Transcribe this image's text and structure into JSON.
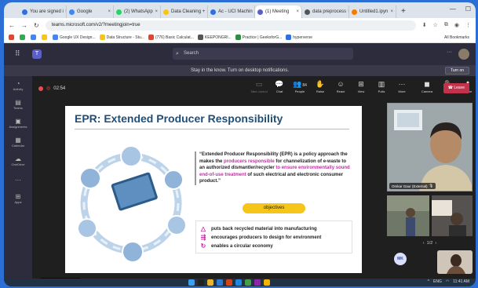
{
  "browser": {
    "tabs": [
      {
        "label": "You are signed i",
        "color": "#2f6fe0",
        "active": false
      },
      {
        "label": "Google",
        "color": "#4285f4",
        "active": false
      },
      {
        "label": "(2) WhatsApp",
        "color": "#25d366",
        "active": false
      },
      {
        "label": "Data Cleaning +",
        "color": "#f5c51a",
        "active": false
      },
      {
        "label": "Ac - UCI Machin",
        "color": "#2f6fe0",
        "active": false
      },
      {
        "label": "(1) Meeting",
        "color": "#5b5fc7",
        "active": true
      },
      {
        "label": "data preprocess",
        "color": "#555555",
        "active": false
      },
      {
        "label": "Untitled1.ipyn",
        "color": "#f57c00",
        "active": false
      }
    ],
    "new_tab": "+",
    "url": "teams.microsoft.com/v2/?meetingjoin=true",
    "bookmarks": [
      {
        "label": "",
        "color": "#e0452f"
      },
      {
        "label": "",
        "color": "#34a853"
      },
      {
        "label": "",
        "color": "#4285f4"
      },
      {
        "label": "",
        "color": "#f5c51a"
      },
      {
        "label": "Google UX Design...",
        "color": "#4285f4"
      },
      {
        "label": "Data Structure - Stu...",
        "color": "#f5c51a"
      },
      {
        "label": "(776) Basic Calculat...",
        "color": "#e0452f"
      },
      {
        "label": "KEEPONGRI...",
        "color": "#555555"
      },
      {
        "label": "Practice | GeeksforG...",
        "color": "#2f8d46"
      },
      {
        "label": "hyperverse",
        "color": "#2f6fe0"
      }
    ],
    "bookmarks_right": "All Bookmarks"
  },
  "teams": {
    "search_placeholder": "Search",
    "notification": "Stay in the know. Turn on desktop notifications.",
    "turn_on": "Turn on",
    "rail": [
      {
        "icon": "◔",
        "label": "Activity"
      },
      {
        "icon": "▤",
        "label": "Teams"
      },
      {
        "icon": "▣",
        "label": "Assignments"
      },
      {
        "icon": "▦",
        "label": "Calendar"
      },
      {
        "icon": "☁",
        "label": "OneDrive"
      },
      {
        "icon": "···",
        "label": ""
      },
      {
        "icon": "⊞",
        "label": "Apps"
      }
    ]
  },
  "meeting": {
    "timer": "02:54",
    "controls": [
      {
        "icon": "▭",
        "label": "Take control",
        "dim": true
      },
      {
        "icon": "💬",
        "label": "Chat",
        "dim": false
      },
      {
        "icon": "👥",
        "label": "People",
        "dim": false,
        "count": "84"
      },
      {
        "icon": "✋",
        "label": "Raise",
        "dim": false
      },
      {
        "icon": "☺",
        "label": "React",
        "dim": false
      },
      {
        "icon": "⊞",
        "label": "View",
        "dim": false
      },
      {
        "icon": "▥",
        "label": "Polls",
        "dim": false
      },
      {
        "icon": "···",
        "label": "More",
        "dim": false
      },
      {
        "icon": "◼",
        "label": "Camera",
        "dim": false,
        "sep": true
      },
      {
        "icon": "🎙",
        "label": "Mic",
        "dim": false
      },
      {
        "icon": "⬆",
        "label": "Share",
        "dim": false
      }
    ],
    "leave": "Leave",
    "slide": {
      "title": "EPR: Extended Producer Responsibility",
      "quote_parts": [
        {
          "text": "“Extended Producer Responsibility (EPR) is a policy approach the makes the ",
          "hl": false
        },
        {
          "text": "producers responsible",
          "hl": true
        },
        {
          "text": " for channelization of e-waste to an authorized dismantler/recycler ",
          "hl": false
        },
        {
          "text": "to ensure environmentally sound end-of-use treatment",
          "hl": true
        },
        {
          "text": " of such electrical and electronic consumer product.”",
          "hl": false
        }
      ],
      "objectives_label": "objectives",
      "objectives": [
        {
          "icon": "△",
          "text": "puts back recycled material into manufacturing"
        },
        {
          "icon": "⇶",
          "text": "encourages producers to design for environment"
        },
        {
          "icon": "↻",
          "text": "enables a circular economy"
        }
      ]
    },
    "speaker_name": "Omkar Gaur (External)",
    "pager": "1/2",
    "self_initials": "MK",
    "presenter_label": "Omkar Gaur (External)"
  },
  "taskbar": {
    "icons": [
      "#3aa0f0",
      "#222222",
      "#e8b42a",
      "#2b7bd6",
      "#d84315",
      "#1e88e5",
      "#43a047",
      "#8e24aa",
      "#f4b400"
    ],
    "lang": "ENG",
    "time": "11:41 AM"
  }
}
